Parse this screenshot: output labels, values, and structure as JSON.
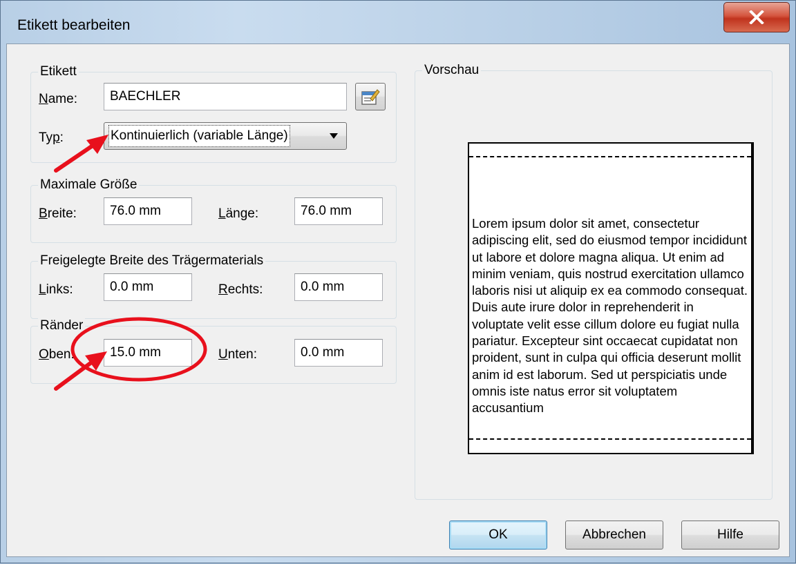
{
  "window": {
    "title": "Etikett bearbeiten",
    "close_glyph": "X"
  },
  "etikett": {
    "legend": "Etikett",
    "name_label_u": "N",
    "name_label_rest": "ame:",
    "name_value": "BAECHLER",
    "typ_label_pre": "Ty",
    "typ_label_u": "p",
    "typ_label_rest": ":",
    "typ_value": "Kontinuierlich (variable Länge)"
  },
  "size": {
    "legend": "Maximale Größe",
    "breite_label_u": "B",
    "breite_label_rest": "reite:",
    "breite_value": "76.0 mm",
    "laenge_label_u": "L",
    "laenge_label_rest": "änge:",
    "laenge_value": "76.0 mm"
  },
  "backing": {
    "legend": "Freigelegte Breite des Trägermaterials",
    "links_label_u": "L",
    "links_label_rest": "inks:",
    "links_value": "0.0 mm",
    "rechts_label_u": "R",
    "rechts_label_rest": "echts:",
    "rechts_value": "0.0 mm"
  },
  "margins": {
    "legend": "Ränder",
    "oben_label_u": "O",
    "oben_label_rest": "ben:",
    "oben_value": "15.0 mm",
    "unten_label_u": "U",
    "unten_label_rest": "nten:",
    "unten_value": "0.0 mm"
  },
  "preview": {
    "legend": "Vorschau",
    "text": "Lorem ipsum dolor sit amet, consectetur adipiscing elit, sed do eiusmod tempor incididunt ut labore et dolore magna aliqua. Ut enim ad minim veniam, quis nostrud exercitation ullamco laboris nisi ut aliquip ex ea commodo consequat. Duis aute irure dolor in reprehenderit in voluptate velit esse cillum dolore eu fugiat nulla pariatur. Excepteur sint occaecat cupidatat non proident, sunt in culpa qui officia deserunt mollit anim id est laborum.   Sed ut perspiciatis unde omnis iste natus error sit voluptatem accusantium"
  },
  "buttons": {
    "ok": "OK",
    "cancel": "Abbrechen",
    "help": "Hilfe"
  },
  "annotations": {
    "arrow_color": "#e8101c",
    "circle_color": "#e8101c"
  },
  "icons": {
    "close": "close-icon",
    "label_properties": "properties-icon",
    "dropdown": "chevron-down-icon"
  }
}
